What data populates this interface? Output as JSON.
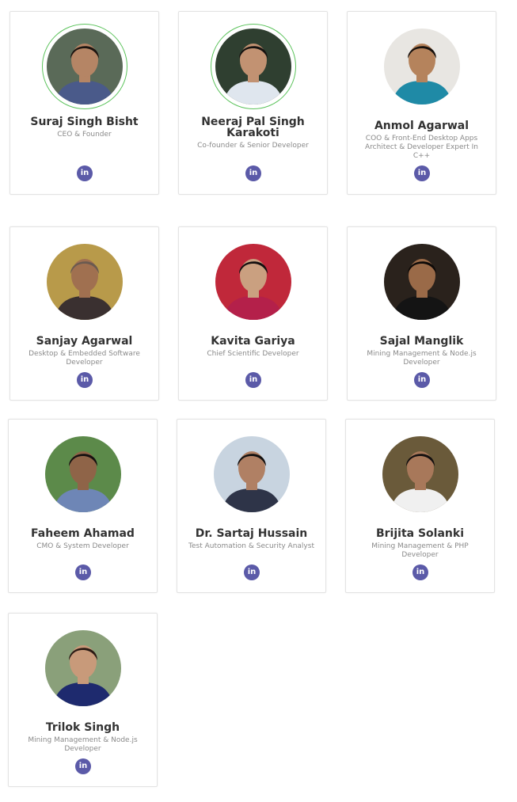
{
  "team": [
    {
      "name": "Suraj Singh Bisht",
      "role": "CEO & Founder",
      "linkedin_label": "in",
      "skin": "#b58565",
      "bg": "#5a6a58",
      "shirt": "#4a5a8a",
      "hair": "#1c1410"
    },
    {
      "name": "Neeraj Pal Singh Karakoti",
      "role": "Co-founder & Senior Developer",
      "linkedin_label": "in",
      "skin": "#c29272",
      "bg": "#2f3f30",
      "shirt": "#dfe6ee",
      "hair": "#161210"
    },
    {
      "name": "Anmol Agarwal",
      "role": "COO & Front-End Desktop Apps Architect & Developer Expert In C++",
      "linkedin_label": "in",
      "skin": "#b5835c",
      "bg": "#e8e6e2",
      "shirt": "#1f8aa6",
      "hair": "#17110d"
    },
    {
      "name": "Sanjay Agarwal",
      "role": "Desktop & Embedded Software Developer",
      "linkedin_label": "in",
      "skin": "#a07050",
      "bg": "#b89a4a",
      "shirt": "#3a3030",
      "hair": "#6a5a50"
    },
    {
      "name": "Kavita Gariya",
      "role": "Chief Scientific Developer",
      "linkedin_label": "in",
      "skin": "#caa080",
      "bg": "#c0283a",
      "shirt": "#b4204a",
      "hair": "#141010"
    },
    {
      "name": "Sajal Manglik",
      "role": "Mining Management & Node.js Developer",
      "linkedin_label": "in",
      "skin": "#9a6a48",
      "bg": "#2a221c",
      "shirt": "#141414",
      "hair": "#0e0a08"
    },
    {
      "name": "Faheem Ahamad",
      "role": "CMO & System Developer",
      "linkedin_label": "in",
      "skin": "#8f6448",
      "bg": "#5c8a4a",
      "shirt": "#6e86b6",
      "hair": "#151010"
    },
    {
      "name": "Dr. Sartaj Hussain",
      "role": "Test Automation & Security Analyst",
      "linkedin_label": "in",
      "skin": "#b08064",
      "bg": "#c8d4e0",
      "shirt": "#2e3448",
      "hair": "#121010"
    },
    {
      "name": "Brijita Solanki",
      "role": "Mining Management & PHP Developer",
      "linkedin_label": "in",
      "skin": "#a8785a",
      "bg": "#6a5a3a",
      "shirt": "#f0f0f0",
      "hair": "#141010"
    },
    {
      "name": "Trilok Singh",
      "role": "Mining Management & Node.js Developer",
      "linkedin_label": "in",
      "skin": "#c89a7a",
      "bg": "#8aa07a",
      "shirt": "#1e2a6e",
      "hair": "#2a1a14"
    }
  ]
}
